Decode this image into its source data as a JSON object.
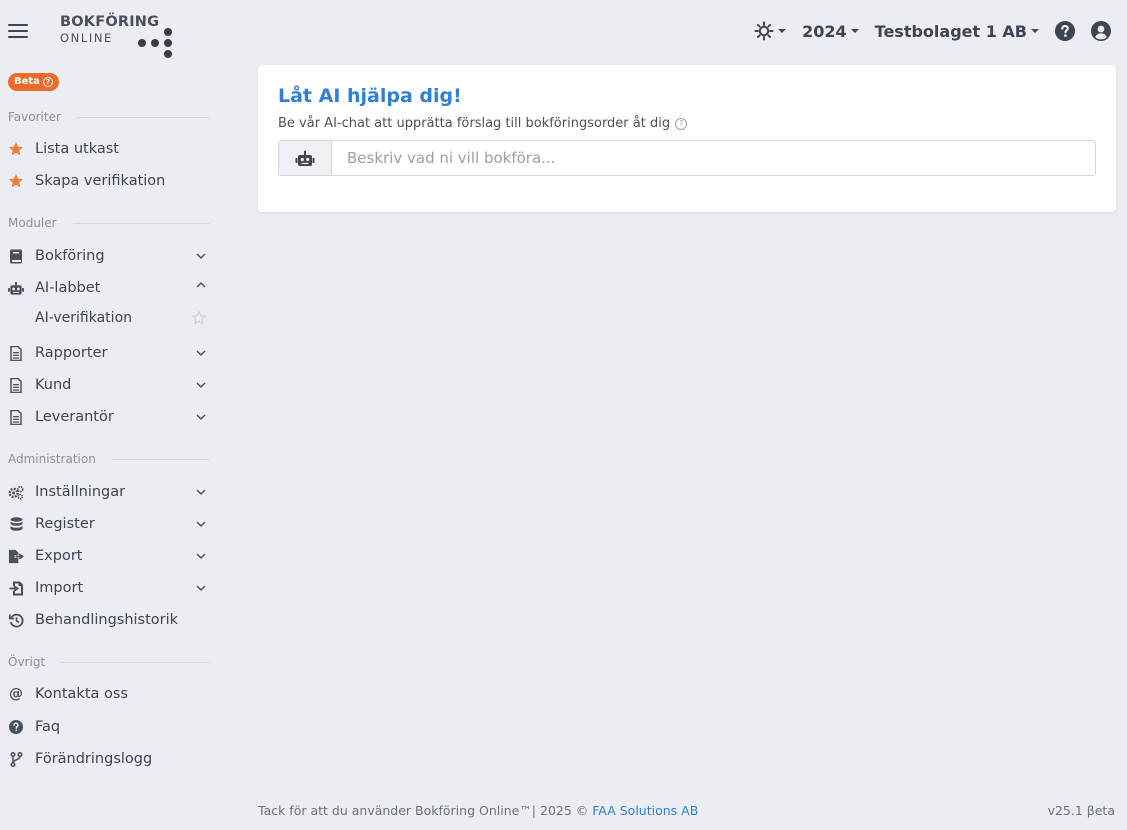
{
  "header": {
    "logo": {
      "line1": "BOKFÖRING",
      "line2": "ONLINE"
    },
    "year": "2024",
    "company": "Testbolaget 1 AB"
  },
  "sidebar": {
    "beta_label": "Beta",
    "sections": {
      "favorites": "Favoriter",
      "modules": "Moduler",
      "administration": "Administration",
      "other": "Övrigt"
    },
    "favorites": [
      {
        "label": "Lista utkast",
        "icon": "star-icon"
      },
      {
        "label": "Skapa verifikation",
        "icon": "star-icon"
      }
    ],
    "modules": [
      {
        "label": "Bokföring",
        "icon": "book-icon"
      },
      {
        "label": "AI-labbet",
        "icon": "robot-icon",
        "expanded": true
      },
      {
        "label": "Rapporter",
        "icon": "document-icon"
      },
      {
        "label": "Kund",
        "icon": "document-icon"
      },
      {
        "label": "Leverantör",
        "icon": "document-icon"
      }
    ],
    "ai_sub": {
      "label": "AI-verifikation"
    },
    "administration": [
      {
        "label": "Inställningar",
        "icon": "gears-icon"
      },
      {
        "label": "Register",
        "icon": "database-icon"
      },
      {
        "label": "Export",
        "icon": "export-icon"
      },
      {
        "label": "Import",
        "icon": "import-icon"
      },
      {
        "label": "Behandlingshistorik",
        "icon": "history-icon"
      }
    ],
    "other": [
      {
        "label": "Kontakta oss",
        "icon": "at-icon"
      },
      {
        "label": "Faq",
        "icon": "question-icon"
      },
      {
        "label": "Förändringslogg",
        "icon": "branch-icon"
      }
    ]
  },
  "card": {
    "title": "Låt AI hjälpa dig!",
    "subtitle": "Be vår AI-chat att upprätta förslag till bokföringsorder åt dig",
    "input_placeholder": "Beskriv vad ni vill bokföra..."
  },
  "footer": {
    "text": "Tack för att du använder Bokföring Online™| 2025 © ",
    "link": "FAA Solutions AB",
    "version": "v25.1 βeta"
  },
  "colors": {
    "accent": "#2f7fd6",
    "beta": "#ee6a2a",
    "star": "#ee7d3c",
    "background": "#ecedf2"
  }
}
